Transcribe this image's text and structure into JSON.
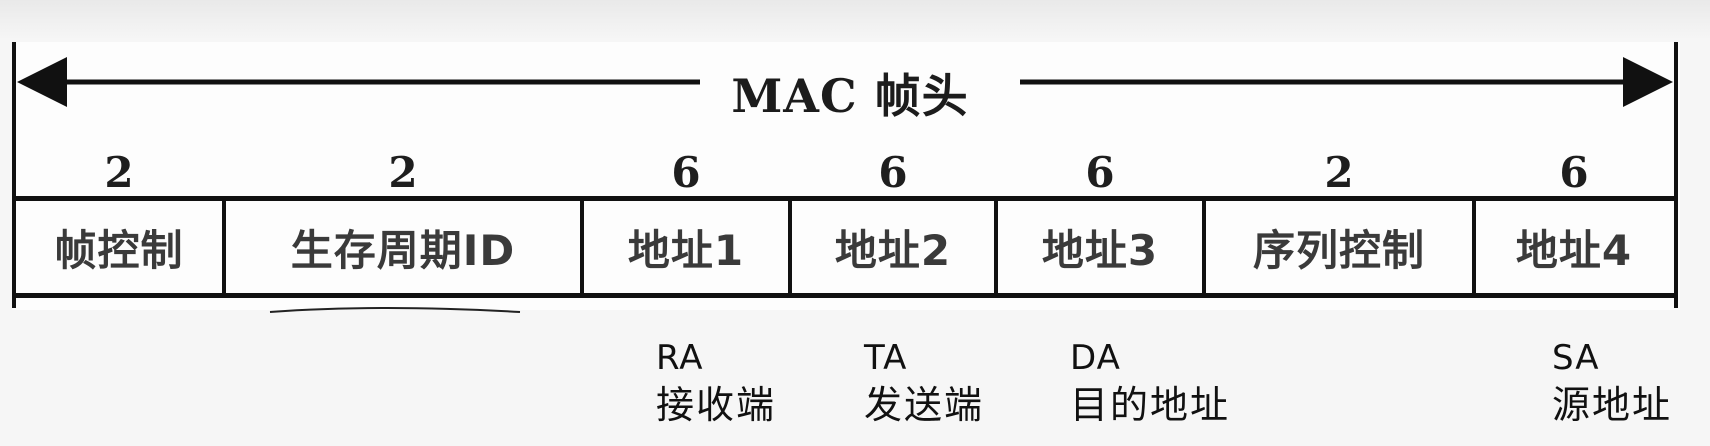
{
  "header": {
    "title": "MAC 帧头"
  },
  "fields": [
    {
      "size": "2",
      "label": "帧控制"
    },
    {
      "size": "2",
      "label": "生存周期ID"
    },
    {
      "size": "6",
      "label": "地址1"
    },
    {
      "size": "6",
      "label": "地址2"
    },
    {
      "size": "6",
      "label": "地址3"
    },
    {
      "size": "2",
      "label": "序列控制"
    },
    {
      "size": "6",
      "label": "地址4"
    }
  ],
  "annotations": [
    {
      "abbr": "RA",
      "desc": "接收端"
    },
    {
      "abbr": "TA",
      "desc": "发送端"
    },
    {
      "abbr": "DA",
      "desc": "目的地址"
    },
    {
      "abbr": "SA",
      "desc": "源地址"
    }
  ],
  "colors": {
    "line": "#111111",
    "field_text": "#3a3a3a",
    "background": "#f6f6f6"
  }
}
